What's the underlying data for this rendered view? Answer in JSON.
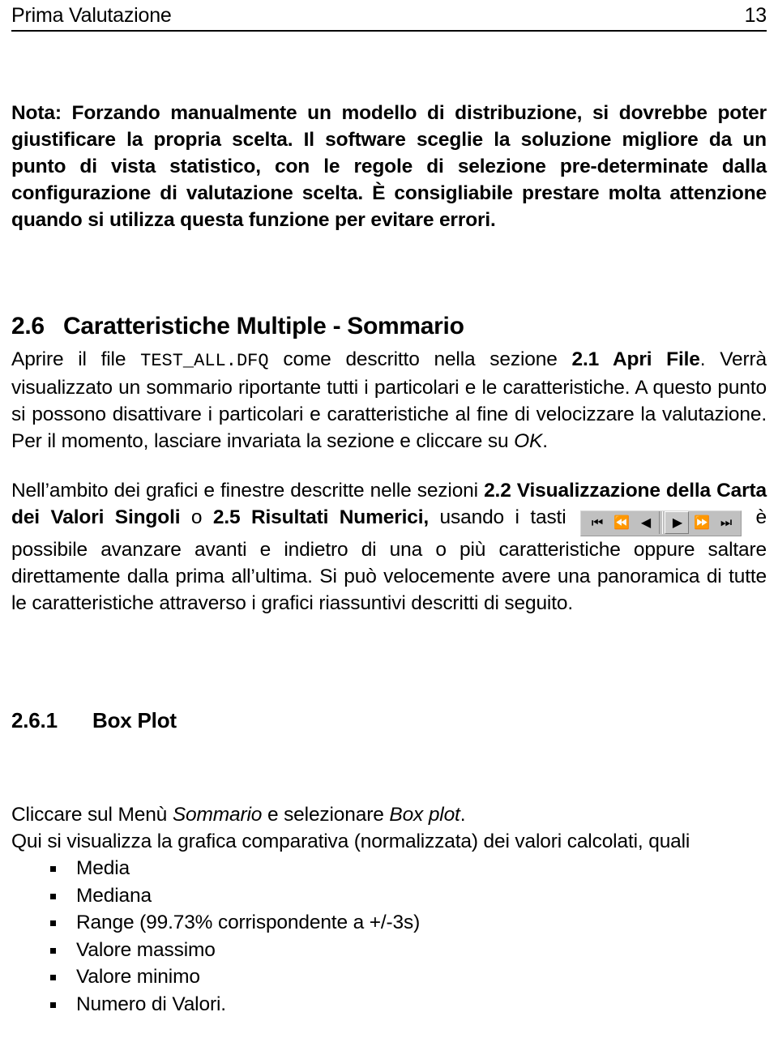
{
  "header": {
    "title": "Prima Valutazione",
    "page_number": "13"
  },
  "note_paragraph": {
    "text": "Nota: Forzando manualmente un modello di distribuzione, si dovrebbe poter giustificare la propria scelta. Il software sceglie la soluzione migliore da un punto di vista statistico, con le regole di selezione pre-determinate dalla configurazione di valutazione scelta. È consigliabile prestare molta attenzione quando si utilizza questa funzione per evitare errori."
  },
  "section_2_6": {
    "number": "2.6",
    "title": "Caratteristiche Multiple - Sommario",
    "para1_a": "Aprire il file ",
    "para1_file": "TEST_ALL.DFQ",
    "para1_b": " come descritto nella sezione ",
    "para1_ref_bold": "2.1 Apri File",
    "para1_c": ". Verrà visualizzato un sommario riportante tutti i particolari e le caratteristiche. A questo punto si possono disattivare i particolari e caratteristiche al fine di velocizzare la valutazione. Per il momento, lasciare invariata la sezione e cliccare su ",
    "para1_ok_italic": "OK",
    "para1_d": ".",
    "para2_a": "Nell’ambito dei grafici e finestre descritte nelle sezioni ",
    "para2_ref1_bold": "2.2   Visualizzazione della Carta dei Valori Singoli",
    "para2_b": " o ",
    "para2_ref2_bold": "2.5 Risultati Numerici,",
    "para2_c": " usando i tasti ",
    "para2_d": " è possibile avanzare avanti e indietro di una o più caratteristiche oppure saltare direttamente dalla prima all’ultima. Si può velocemente avere una panoramica di tutte le caratteristiche attraverso i grafici riassuntivi descritti di seguito."
  },
  "nav_toolbar": {
    "buttons": [
      {
        "name": "skip-to-first",
        "glyph": "⏮"
      },
      {
        "name": "rewind",
        "glyph": "⏪"
      },
      {
        "name": "previous",
        "glyph": "◀"
      },
      {
        "name": "next",
        "glyph": "▶"
      },
      {
        "name": "fast-forward",
        "glyph": "⏩"
      },
      {
        "name": "skip-to-last",
        "glyph": "⏭"
      }
    ]
  },
  "section_2_6_1": {
    "number": "2.6.1",
    "title": "Box Plot",
    "para_a": "Cliccare sul Menù ",
    "para_menu_italic": "Sommario",
    "para_b": " e selezionare ",
    "para_item_italic": "Box plot",
    "para_c": ".",
    "para2": "Qui si visualizza la grafica comparativa (normalizzata) dei valori calcolati, quali",
    "bullets": [
      "Media",
      "Mediana",
      "Range (99.73% corrispondente a +/-3s)",
      "Valore massimo",
      "Valore minimo",
      "Numero di Valori."
    ]
  }
}
